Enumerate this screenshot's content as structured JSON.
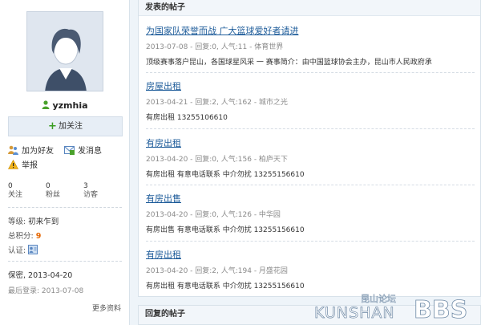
{
  "profile": {
    "username": "yzmhia",
    "follow_label": "加关注",
    "add_friend_label": "加为好友",
    "message_label": "发消息",
    "report_label": "举报",
    "stats": [
      {
        "num": "0",
        "label": "关注"
      },
      {
        "num": "0",
        "label": "粉丝"
      },
      {
        "num": "3",
        "label": "访客"
      }
    ],
    "level_label": "等级:",
    "level_value": "初来乍到",
    "points_label": "总积分:",
    "points_value": "9",
    "verify_label": "认证:",
    "secret_line": "保密,  2013-04-20",
    "last_login": "最后登录:  2013-07-08",
    "more_label": "更多资料"
  },
  "posts_panel": {
    "title": "发表的帖子",
    "posts": [
      {
        "title": "为国家队荣誉而战 广大篮球爱好者请进",
        "meta": "2013-07-08 - 回复:0, 人气:11 - 体育世界",
        "body": "顶级赛事落户昆山，各国球星风采 一    赛事简介：由中国篮球协会主办，昆山市人民政府承"
      },
      {
        "title": "房屋出租",
        "meta": "2013-04-21 - 回复:2, 人气:162 - 城市之光",
        "body": "有房出租    13255106610"
      },
      {
        "title": "有房出租",
        "meta": "2013-04-20 - 回复:0, 人气:156 - 柏庐天下",
        "body": "有房出租    有意电话联系    中介勿扰    13255156610"
      },
      {
        "title": "有房出售",
        "meta": "2013-04-20 - 回复:0, 人气:126 - 中华园",
        "body": "有房出售    有意电话联系    中介勿扰    13255156610"
      },
      {
        "title": "有房出租",
        "meta": "2013-04-20 - 回复:2, 人气:194 - 月盛花园",
        "body": "有房出租    有意电话联系    中介勿扰    13255156610"
      }
    ]
  },
  "replies_panel": {
    "title": "回复的帖子"
  },
  "watermark": {
    "cn": "昆山论坛",
    "en": "KUNSHAN",
    "bbs": "BBS"
  },
  "colors": {
    "link": "#1e5c9a",
    "accent": "#e56600",
    "panel_bg": "#eef4f9"
  }
}
